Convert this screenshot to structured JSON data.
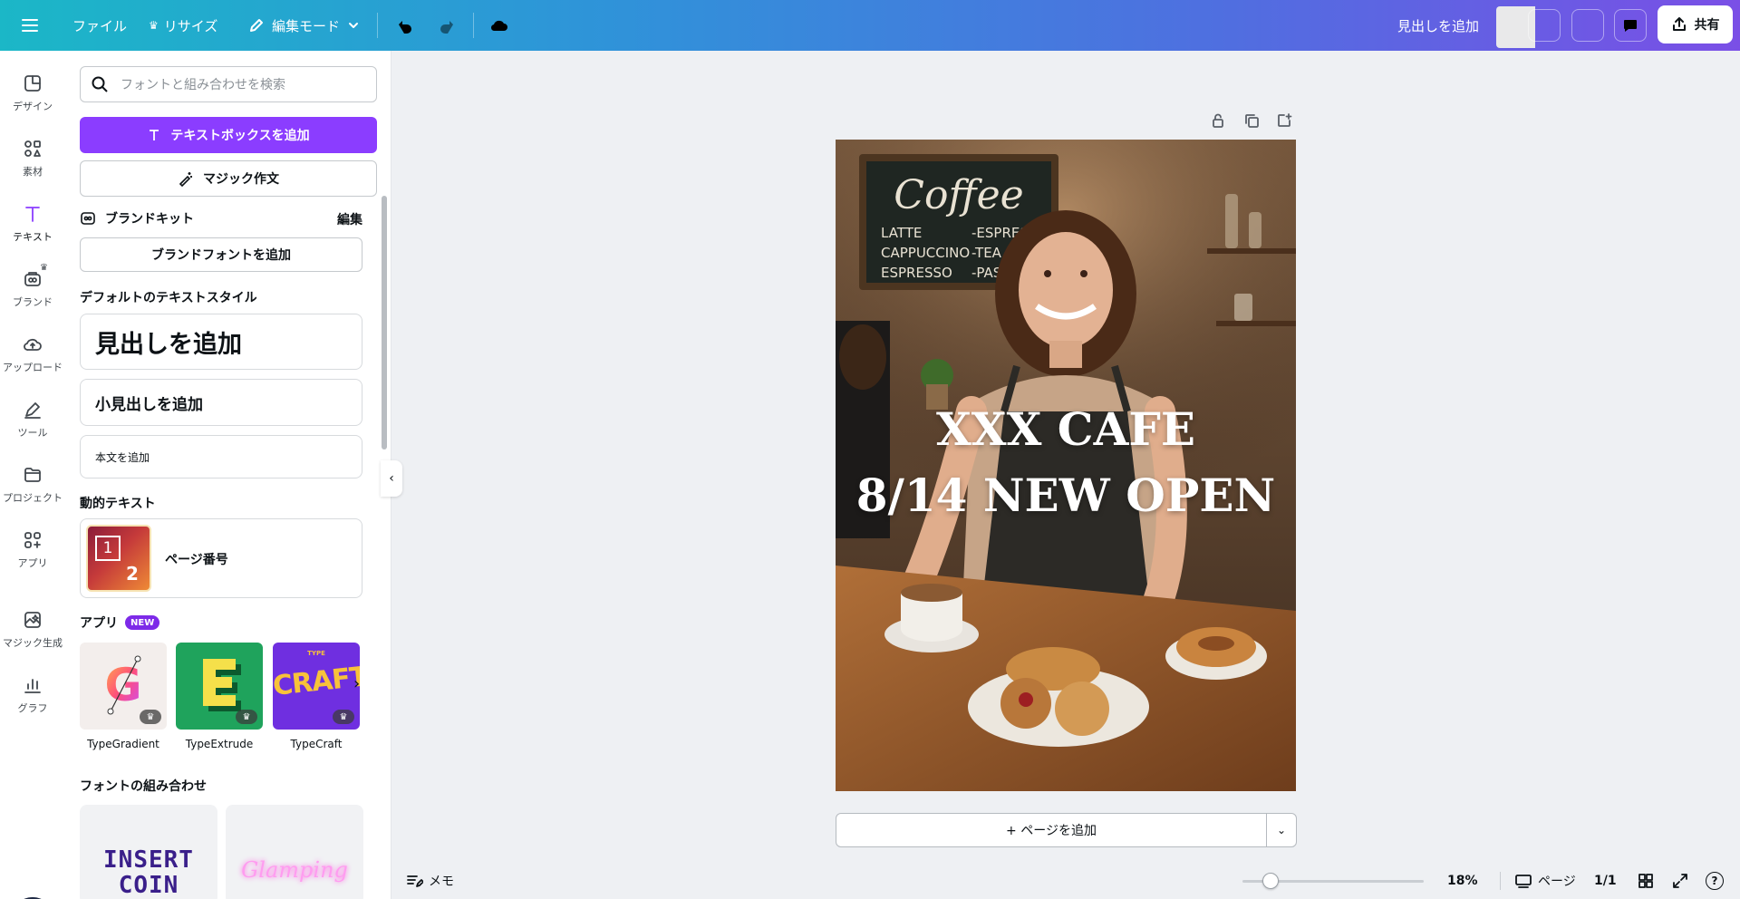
{
  "colors": {
    "accent": "#8b3dff",
    "topbar_start": "#1bb7c7",
    "topbar_end": "#7a4fe6",
    "new_badge": "#7d2ae8"
  },
  "topbar": {
    "menu_icon": "hamburger-icon",
    "file_label": "ファイル",
    "resize_label": "リサイズ",
    "edit_mode_label": "編集モード",
    "design_title": "見出しを追加",
    "share_label": "共有"
  },
  "rail": {
    "items": [
      {
        "label": "デザイン",
        "icon": "layout-icon"
      },
      {
        "label": "素材",
        "icon": "elements-icon"
      },
      {
        "label": "テキスト",
        "icon": "text-icon"
      },
      {
        "label": "ブランド",
        "icon": "brand-icon"
      },
      {
        "label": "アップロード",
        "icon": "cloud-upload-icon"
      },
      {
        "label": "ツール",
        "icon": "pen-icon"
      },
      {
        "label": "プロジェクト",
        "icon": "folder-icon"
      },
      {
        "label": "アプリ",
        "icon": "apps-icon"
      },
      {
        "label": "マジック生成",
        "icon": "magic-media-icon"
      },
      {
        "label": "グラフ",
        "icon": "chart-icon"
      }
    ],
    "active_index": 2
  },
  "panel": {
    "search_placeholder": "フォントと組み合わせを検索",
    "add_textbox": "テキストボックスを追加",
    "magic_write": "マジック作文",
    "brand_kit_title": "ブランドキット",
    "brand_kit_edit": "編集",
    "add_brand_font": "ブランドフォントを追加",
    "default_styles_title": "デフォルトのテキストスタイル",
    "heading": "見出しを追加",
    "subheading": "小見出しを追加",
    "body": "本文を追加",
    "dynamic_text_title": "動的テキスト",
    "page_number": "ページ番号",
    "page_number_thumb": [
      "1",
      "2"
    ],
    "apps_title": "アプリ",
    "new_badge": "NEW",
    "apps": [
      {
        "name": "TypeGradient"
      },
      {
        "name": "TypeExtrude"
      },
      {
        "name": "TypeCraft",
        "tile_text": "CRAFT",
        "tile_subtext": "TYPE"
      }
    ],
    "font_combos_title": "フォントの組み合わせ",
    "font_combos": [
      {
        "line1": "INSERT",
        "line2": "COIN"
      },
      {
        "line1": "Glamping"
      }
    ]
  },
  "design": {
    "line1": "XXX CAFE",
    "line2": "8/14 NEW OPEN",
    "chalkboard": {
      "title": "Coffee",
      "left": [
        "LATTE",
        "CAPPUCCINO",
        "ESPRESSO"
      ],
      "right": [
        "-ESPRESSO",
        "-TEA",
        "-PASTRIES"
      ]
    },
    "add_page_label": "+ ページを追加"
  },
  "bottombar": {
    "notes_label": "メモ",
    "zoom": "18%",
    "zoom_value": 0.18,
    "pages_label": "ページ",
    "page_count": "1/1",
    "help": "?"
  }
}
